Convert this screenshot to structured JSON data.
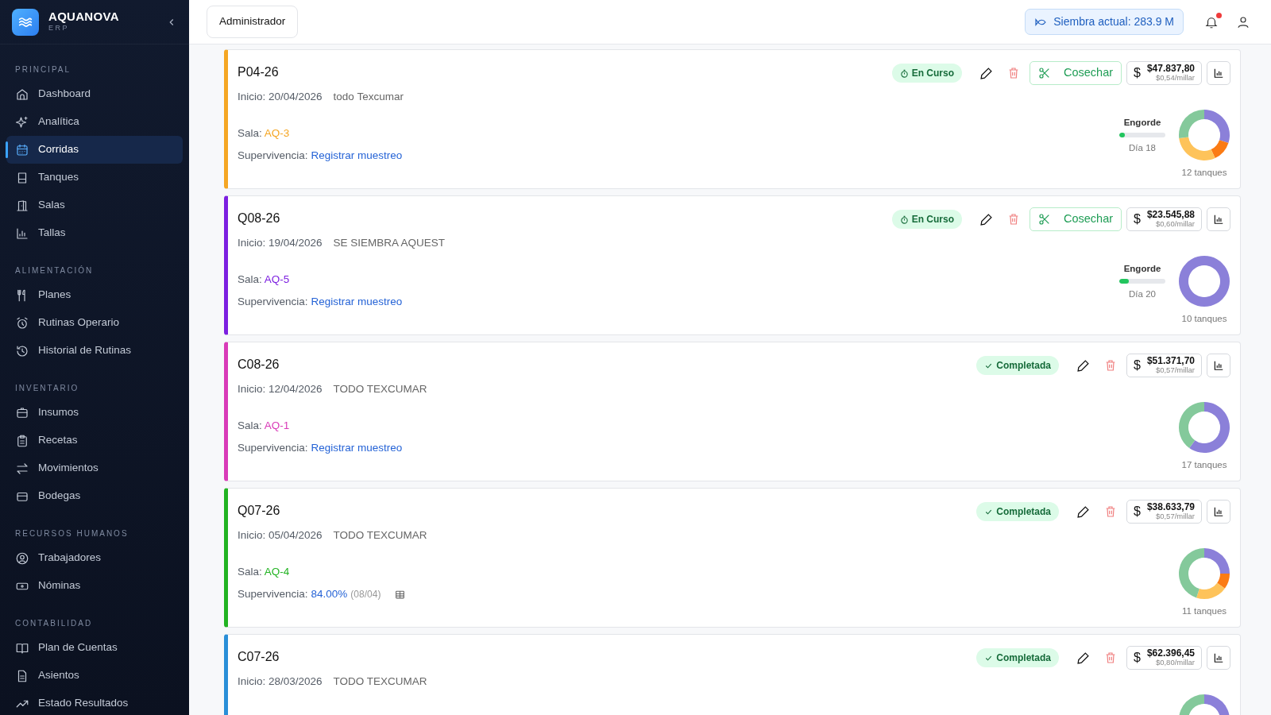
{
  "sidebar": {
    "brand": "AQUANOVA",
    "brand_sub": "ERP",
    "sections": [
      {
        "title": "PRINCIPAL",
        "items": [
          {
            "label": "Dashboard",
            "selected": false
          },
          {
            "label": "Analítica",
            "selected": false
          },
          {
            "label": "Corridas",
            "selected": true
          },
          {
            "label": "Tanques",
            "selected": false
          },
          {
            "label": "Salas",
            "selected": false
          },
          {
            "label": "Tallas",
            "selected": false
          }
        ]
      },
      {
        "title": "ALIMENTACIÓN",
        "items": [
          {
            "label": "Planes",
            "selected": false
          },
          {
            "label": "Rutinas Operario",
            "selected": false
          },
          {
            "label": "Historial de Rutinas",
            "selected": false
          }
        ]
      },
      {
        "title": "INVENTARIO",
        "items": [
          {
            "label": "Insumos",
            "selected": false
          },
          {
            "label": "Recetas",
            "selected": false
          },
          {
            "label": "Movimientos",
            "selected": false
          },
          {
            "label": "Bodegas",
            "selected": false
          }
        ]
      },
      {
        "title": "RECURSOS HUMANOS",
        "items": [
          {
            "label": "Trabajadores",
            "selected": false
          },
          {
            "label": "Nóminas",
            "selected": false
          }
        ]
      },
      {
        "title": "CONTABILIDAD",
        "items": [
          {
            "label": "Plan de Cuentas",
            "selected": false
          },
          {
            "label": "Asientos",
            "selected": false
          },
          {
            "label": "Estado Resultados",
            "selected": false
          }
        ]
      }
    ]
  },
  "header": {
    "role": "Administrador",
    "siembra": "Siembra actual: 283.9 M",
    "unread": true
  },
  "runs": [
    {
      "code": "P04-26",
      "color": "#f5a623",
      "start": "Inicio: 20/04/2026",
      "note": "todo Texcumar",
      "sala_label": "Sala:",
      "sala": "AQ-3",
      "survival_label": "Supervivencia:",
      "survival": {
        "kind": "link",
        "text": "Registrar muestreo"
      },
      "status": {
        "kind": "active",
        "text": "En Curso"
      },
      "harvest": "Cosechar",
      "currency": "$",
      "cost": "$47.837,80",
      "per_millar": "$0,54/millar",
      "stage": {
        "label": "Engorde",
        "level": 0.12,
        "day": "Día 18"
      },
      "chart_data": {
        "type": "donut",
        "values": [
          30,
          13,
          30,
          27
        ],
        "colors": [
          "#8b80d9",
          "#fb7b14",
          "#fec35a",
          "#84c99b"
        ]
      },
      "tanks": "12 tanques"
    },
    {
      "code": "Q08-26",
      "color": "#7c1fe0",
      "start": "Inicio: 19/04/2026",
      "note": "SE SIEMBRA AQUEST",
      "sala_label": "Sala:",
      "sala": "AQ-5",
      "survival_label": "Supervivencia:",
      "survival": {
        "kind": "link",
        "text": "Registrar muestreo"
      },
      "status": {
        "kind": "active",
        "text": "En Curso"
      },
      "harvest": "Cosechar",
      "currency": "$",
      "cost": "$23.545,88",
      "per_millar": "$0,60/millar",
      "stage": {
        "label": "Engorde",
        "level": 0.2,
        "day": "Día 20"
      },
      "chart_data": {
        "type": "donut",
        "values": [
          100
        ],
        "colors": [
          "#8b80d9"
        ]
      },
      "tanks": "10 tanques"
    },
    {
      "code": "C08-26",
      "color": "#d93bb8",
      "start": "Inicio: 12/04/2026",
      "note": "TODO TEXCUMAR",
      "sala_label": "Sala:",
      "sala": "AQ-1",
      "survival_label": "Supervivencia:",
      "survival": {
        "kind": "link",
        "text": "Registrar muestreo"
      },
      "status": {
        "kind": "done",
        "text": "Completada"
      },
      "currency": "$",
      "cost": "$51.371,70",
      "per_millar": "$0,57/millar",
      "chart_data": {
        "type": "donut",
        "values": [
          60,
          40
        ],
        "colors": [
          "#8b80d9",
          "#84c99b"
        ]
      },
      "tanks": "17 tanques"
    },
    {
      "code": "Q07-26",
      "color": "#22b322",
      "start": "Inicio: 05/04/2026",
      "note": "TODO TEXCUMAR",
      "sala_label": "Sala:",
      "sala": "AQ-4",
      "survival_label": "Supervivencia:",
      "survival": {
        "kind": "value",
        "text": "84.00%",
        "date": "(08/04)"
      },
      "status": {
        "kind": "done",
        "text": "Completada"
      },
      "currency": "$",
      "cost": "$38.633,79",
      "per_millar": "$0,57/millar",
      "chart_data": {
        "type": "donut",
        "values": [
          25,
          10,
          20,
          45
        ],
        "colors": [
          "#8b80d9",
          "#fb7b14",
          "#fec35a",
          "#84c99b"
        ]
      },
      "tanks": "11 tanques"
    },
    {
      "code": "C07-26",
      "color": "#2a8fd8",
      "start": "Inicio: 28/03/2026",
      "note": "TODO TEXCUMAR",
      "status": {
        "kind": "done",
        "text": "Completada"
      },
      "currency": "$",
      "cost": "$62.396,45",
      "per_millar": "$0,80/millar",
      "chart_data": {
        "type": "donut",
        "values": [
          50,
          50
        ],
        "colors": [
          "#8b80d9",
          "#84c99b"
        ]
      }
    }
  ]
}
